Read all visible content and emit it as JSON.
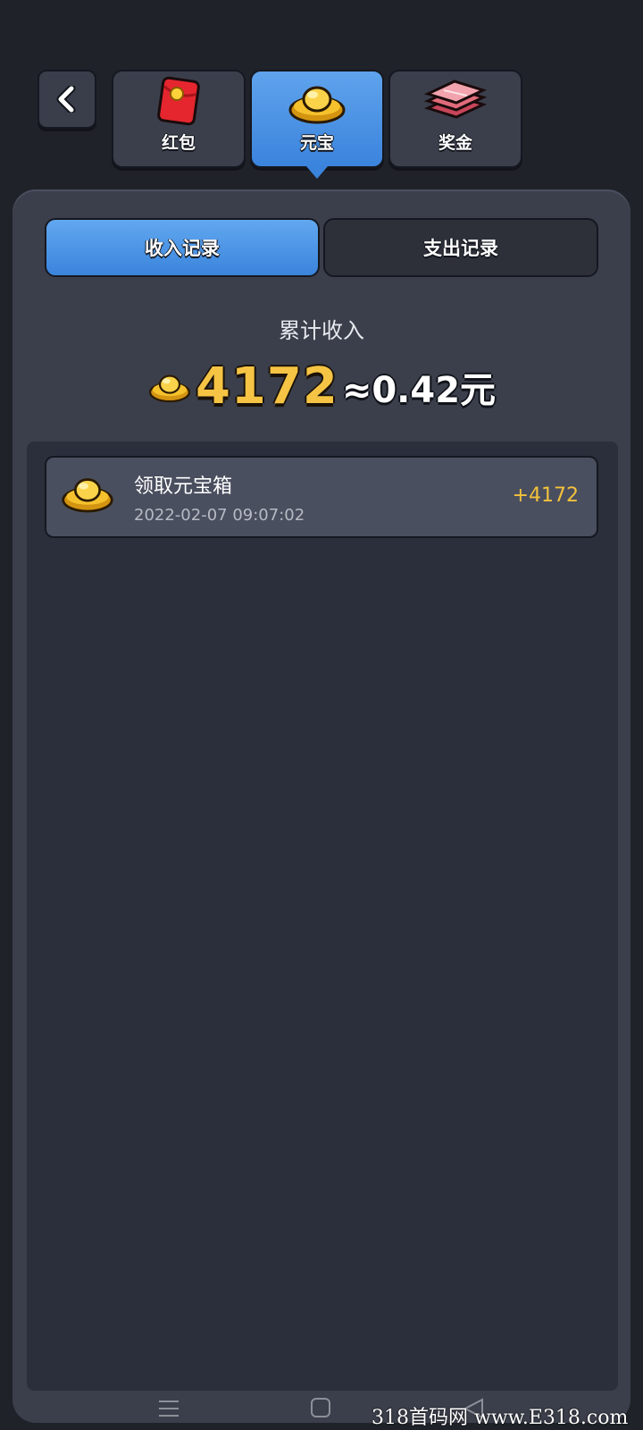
{
  "header": {
    "back_icon": "chevron-left-icon",
    "tabs": [
      {
        "label": "红包",
        "icon": "red-envelope-icon",
        "active": false
      },
      {
        "label": "元宝",
        "icon": "gold-ingot-icon",
        "active": true
      },
      {
        "label": "奖金",
        "icon": "cash-stack-icon",
        "active": false
      }
    ]
  },
  "segments": {
    "income_label": "收入记录",
    "expense_label": "支出记录",
    "active": "income"
  },
  "summary": {
    "label": "累计收入",
    "amount": "4172",
    "approx": "≈0.42元"
  },
  "records": [
    {
      "title": "领取元宝箱",
      "time": "2022-02-07 09:07:02",
      "amount": "+4172",
      "icon": "gold-ingot-icon"
    }
  ],
  "watermark": "318首码网 www.E318.com",
  "colors": {
    "accent_blue": "#3b84dd",
    "gold": "#f6c444",
    "background": "#1f2229",
    "panel": "#3b3f4b"
  }
}
